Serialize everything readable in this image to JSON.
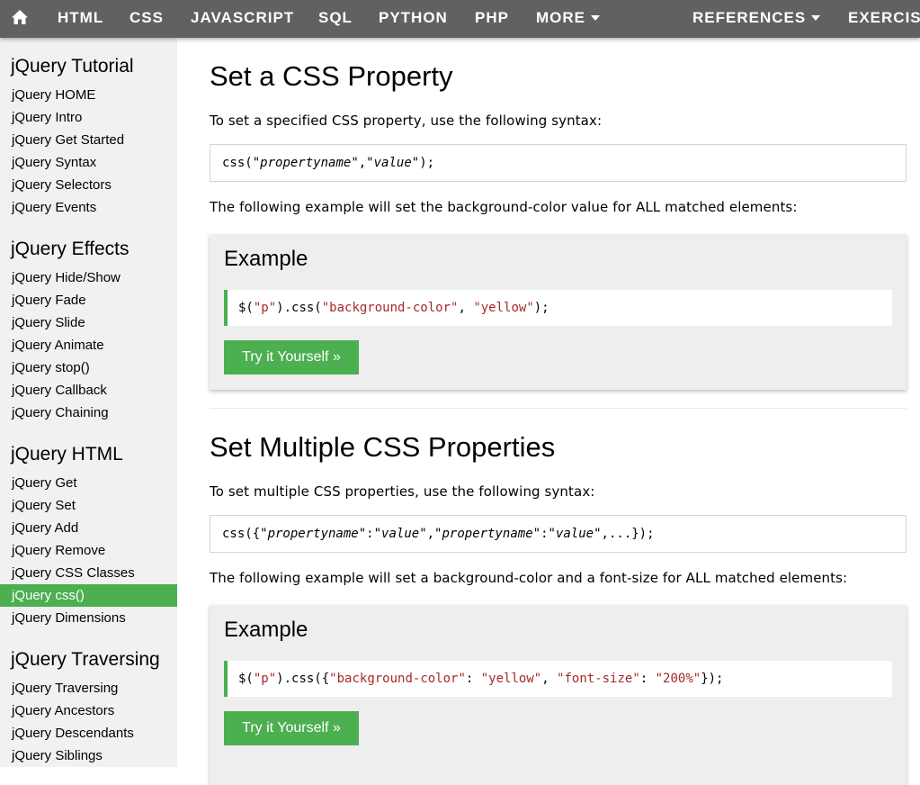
{
  "topnav": {
    "home_icon": "home-icon",
    "items": [
      {
        "label": "HTML"
      },
      {
        "label": "CSS"
      },
      {
        "label": "JAVASCRIPT"
      },
      {
        "label": "SQL"
      },
      {
        "label": "PYTHON"
      },
      {
        "label": "PHP"
      },
      {
        "label": "MORE"
      },
      {
        "label": "REFERENCES"
      },
      {
        "label": "EXERCIS"
      }
    ]
  },
  "sidebar": {
    "sections": [
      {
        "heading": "jQuery Tutorial",
        "links": [
          "jQuery HOME",
          "jQuery Intro",
          "jQuery Get Started",
          "jQuery Syntax",
          "jQuery Selectors",
          "jQuery Events"
        ]
      },
      {
        "heading": "jQuery Effects",
        "links": [
          "jQuery Hide/Show",
          "jQuery Fade",
          "jQuery Slide",
          "jQuery Animate",
          "jQuery stop()",
          "jQuery Callback",
          "jQuery Chaining"
        ]
      },
      {
        "heading": "jQuery HTML",
        "links": [
          "jQuery Get",
          "jQuery Set",
          "jQuery Add",
          "jQuery Remove",
          "jQuery CSS Classes",
          "jQuery css()",
          "jQuery Dimensions"
        ]
      },
      {
        "heading": "jQuery Traversing",
        "links": [
          "jQuery Traversing",
          "jQuery Ancestors",
          "jQuery Descendants",
          "jQuery Siblings"
        ]
      }
    ],
    "active": "jQuery css()"
  },
  "main": {
    "section1": {
      "title": "Set a CSS Property",
      "intro": "To set a specified CSS property, use the following syntax:",
      "syntax": {
        "p1": "css(\"",
        "p2": "propertyname",
        "p3": "\",\"",
        "p4": "value",
        "p5": "\");"
      },
      "desc": "The following example will set the background-color value for ALL matched elements:",
      "example": {
        "heading": "Example",
        "code": {
          "c1": "$(",
          "c2": "\"p\"",
          "c3": ").css(",
          "c4": "\"background-color\"",
          "c5": ", ",
          "c6": "\"yellow\"",
          "c7": ");"
        },
        "button": "Try it Yourself »"
      }
    },
    "section2": {
      "title": "Set Multiple CSS Properties",
      "intro": "To set multiple CSS properties, use the following syntax:",
      "syntax": {
        "p1": "css({\"",
        "p2": "propertyname",
        "p3": "\":\"",
        "p4": "value",
        "p5": "\",\"",
        "p6": "propertyname",
        "p7": "\":\"",
        "p8": "value",
        "p9": "\",...});"
      },
      "desc": "The following example will set a background-color and a font-size for ALL matched elements:",
      "example": {
        "heading": "Example",
        "code": {
          "c1": "$(",
          "c2": "\"p\"",
          "c3": ").css({",
          "c4": "\"background-color\"",
          "c5": ": ",
          "c6": "\"yellow\"",
          "c7": ", ",
          "c8": "\"font-size\"",
          "c9": ": ",
          "c10": "\"200%\"",
          "c11": "});"
        },
        "button": "Try it Yourself »"
      }
    }
  },
  "colors": {
    "accent": "#4CAF50",
    "nav": "#616161",
    "sidebar": "#f1f1f1",
    "string": "#a52a2a"
  }
}
